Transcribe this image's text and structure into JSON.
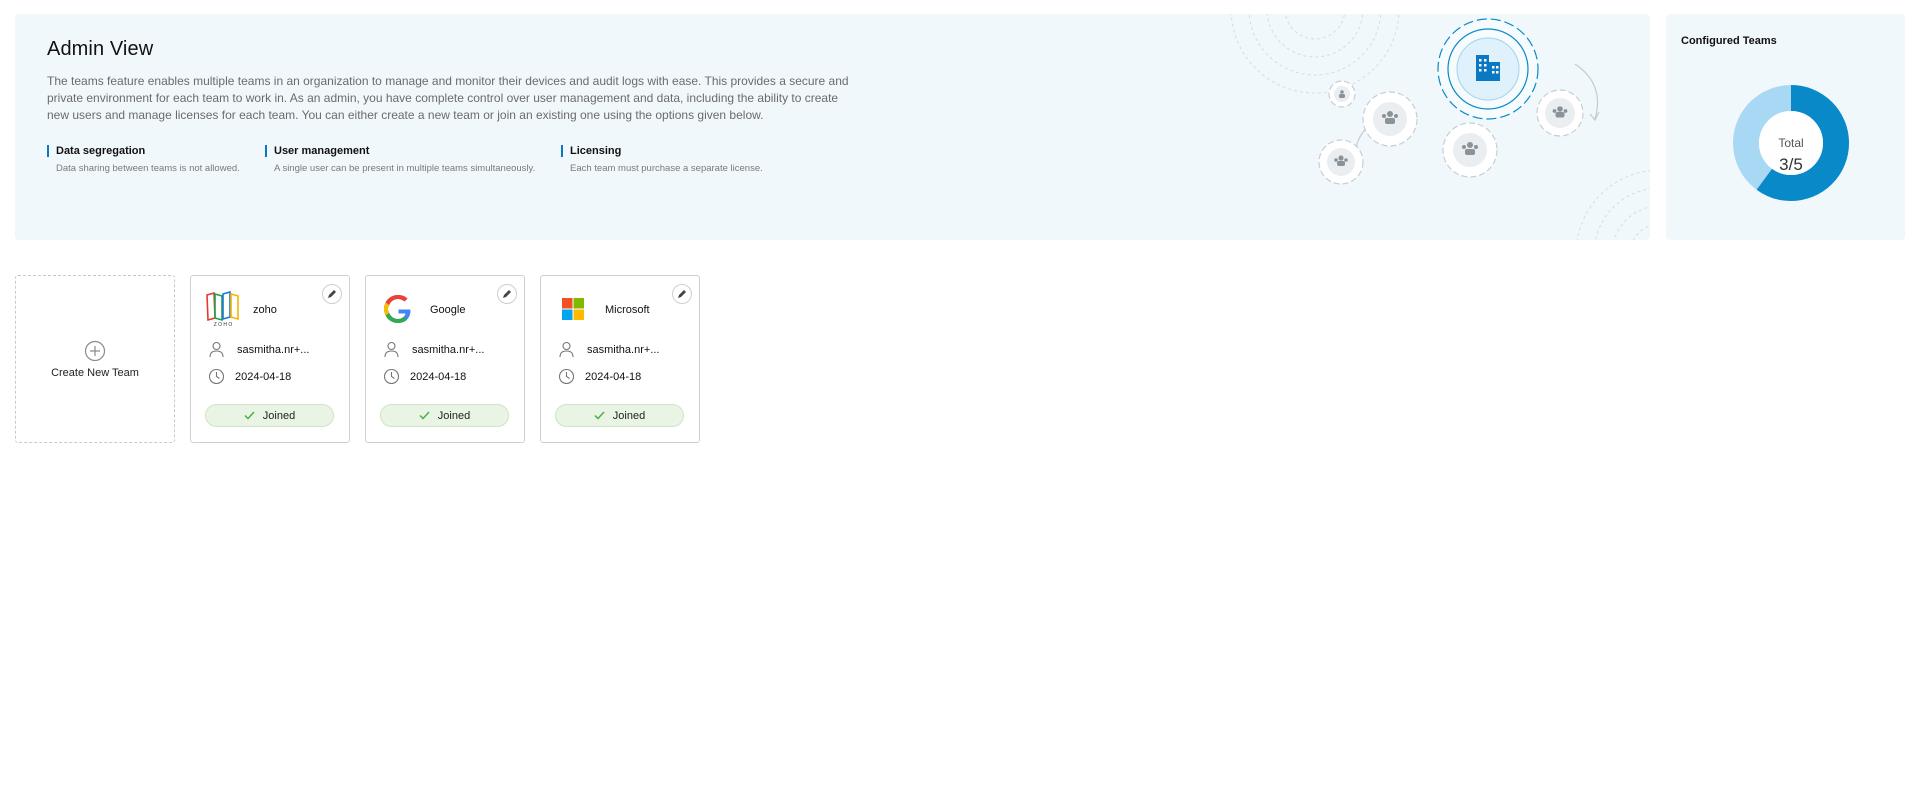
{
  "hero": {
    "title": "Admin View",
    "description": "The teams feature enables multiple teams in an organization to manage and monitor their devices and audit logs with ease. This provides a secure and private environment for each team to work in. As an admin, you have complete control over user management and data, including the ability to create new users and manage licenses for each team. You can either create a new team or join an existing one using the options given below.",
    "features": [
      {
        "title": "Data segregation",
        "desc": "Data sharing between teams is not allowed."
      },
      {
        "title": "User management",
        "desc": "A single user can be present in multiple teams simultaneously."
      },
      {
        "title": "Licensing",
        "desc": "Each team must purchase a separate license."
      }
    ],
    "illustration_icon": "building-gear-icon"
  },
  "configured": {
    "title": "Configured Teams",
    "total_label": "Total",
    "total_value": "3/5",
    "used": 3,
    "limit": 5,
    "colors": {
      "used": "#0a89c8",
      "remaining": "#a9d8f5"
    }
  },
  "create": {
    "label": "Create New Team",
    "icon": "plus-circle-icon"
  },
  "teams": [
    {
      "name": "zoho",
      "owner": "sasmitha.nr+...",
      "date": "2024-04-18",
      "status": "Joined",
      "logo": "zoho-logo"
    },
    {
      "name": "Google",
      "owner": "sasmitha.nr+...",
      "date": "2024-04-18",
      "status": "Joined",
      "logo": "google-logo"
    },
    {
      "name": "Microsoft",
      "owner": "sasmitha.nr+...",
      "date": "2024-04-18",
      "status": "Joined",
      "logo": "microsoft-logo"
    }
  ],
  "colors": {
    "accent": "#0a78c2",
    "panel_bg": "#f0f8fc",
    "joined_bg": "#eaf4e5",
    "check": "#4caf50"
  }
}
